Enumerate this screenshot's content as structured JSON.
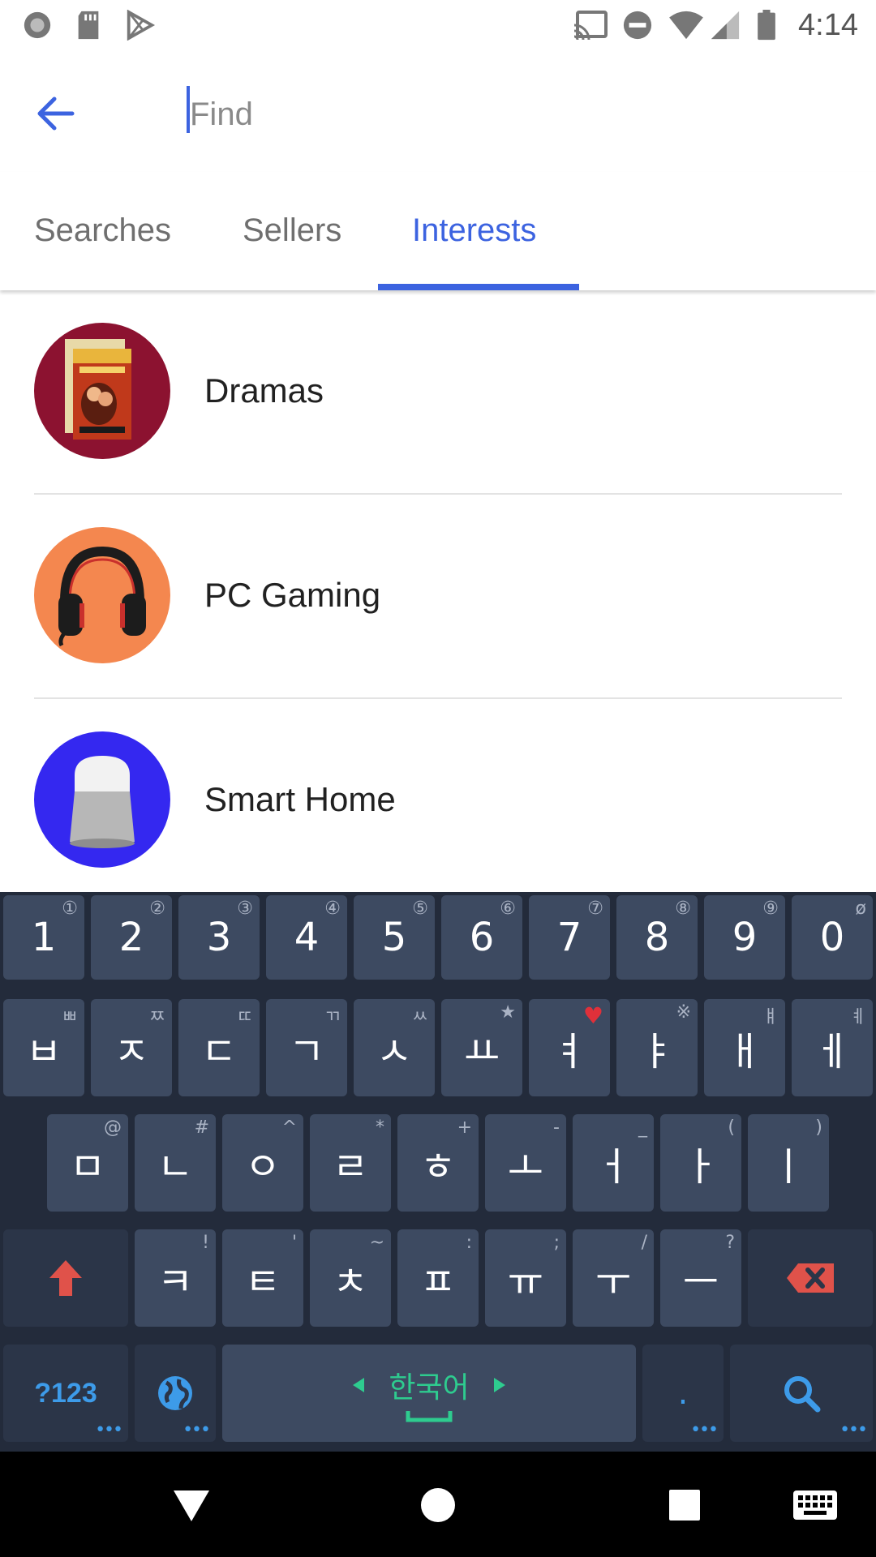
{
  "status_bar": {
    "time": "4:14",
    "icons": [
      "record-icon",
      "sd-card-icon",
      "play-store-icon",
      "cast-icon",
      "do-not-disturb-icon",
      "wifi-icon",
      "signal-icon",
      "battery-icon"
    ]
  },
  "search": {
    "placeholder": "Find",
    "value": ""
  },
  "tabs": [
    {
      "label": "Searches",
      "active": false
    },
    {
      "label": "Sellers",
      "active": false
    },
    {
      "label": "Interests",
      "active": true
    }
  ],
  "interests": [
    {
      "label": "Dramas",
      "image": "gone-with-the-wind-cover",
      "bg": "#8c1230"
    },
    {
      "label": "PC Gaming",
      "image": "gaming-headset",
      "bg": "#f4874f"
    },
    {
      "label": "Smart Home",
      "image": "smart-speaker",
      "bg": "#3428f0"
    }
  ],
  "keyboard": {
    "row1": [
      {
        "key": "1",
        "hint": "①"
      },
      {
        "key": "2",
        "hint": "②"
      },
      {
        "key": "3",
        "hint": "③"
      },
      {
        "key": "4",
        "hint": "④"
      },
      {
        "key": "5",
        "hint": "⑤"
      },
      {
        "key": "6",
        "hint": "⑥"
      },
      {
        "key": "7",
        "hint": "⑦"
      },
      {
        "key": "8",
        "hint": "⑧"
      },
      {
        "key": "9",
        "hint": "⑨"
      },
      {
        "key": "0",
        "hint": "ø"
      }
    ],
    "row2": [
      {
        "key": "ㅂ",
        "hint": "ㅃ"
      },
      {
        "key": "ㅈ",
        "hint": "ㅉ"
      },
      {
        "key": "ㄷ",
        "hint": "ㄸ"
      },
      {
        "key": "ㄱ",
        "hint": "ㄲ"
      },
      {
        "key": "ㅅ",
        "hint": "ㅆ"
      },
      {
        "key": "ㅛ",
        "hint": "★"
      },
      {
        "key": "ㅕ",
        "hint": "♥"
      },
      {
        "key": "ㅑ",
        "hint": "※"
      },
      {
        "key": "ㅐ",
        "hint": "ㅒ"
      },
      {
        "key": "ㅔ",
        "hint": "ㅖ"
      }
    ],
    "row3": [
      {
        "key": "ㅁ",
        "hint": "@"
      },
      {
        "key": "ㄴ",
        "hint": "#"
      },
      {
        "key": "ㅇ",
        "hint": "^"
      },
      {
        "key": "ㄹ",
        "hint": "*"
      },
      {
        "key": "ㅎ",
        "hint": "+"
      },
      {
        "key": "ㅗ",
        "hint": "-"
      },
      {
        "key": "ㅓ",
        "hint": "_"
      },
      {
        "key": "ㅏ",
        "hint": "("
      },
      {
        "key": "ㅣ",
        "hint": ")"
      }
    ],
    "row4": [
      {
        "key": "ㅋ",
        "hint": "!"
      },
      {
        "key": "ㅌ",
        "hint": "'"
      },
      {
        "key": "ㅊ",
        "hint": "~"
      },
      {
        "key": "ㅍ",
        "hint": ":"
      },
      {
        "key": "ㅠ",
        "hint": ";"
      },
      {
        "key": "ㅜ",
        "hint": "/"
      },
      {
        "key": "ㅡ",
        "hint": "?"
      }
    ],
    "symbols_label": "?123",
    "language_label": "한국어",
    "period_label": ".",
    "accent_color": "#3d9be9",
    "language_color": "#2ecc8f",
    "shift_color": "#e0524a"
  },
  "nav_bar": {
    "buttons": [
      "back-triangle-icon",
      "home-circle-icon",
      "recents-square-icon",
      "keyboard-switch-icon"
    ]
  }
}
